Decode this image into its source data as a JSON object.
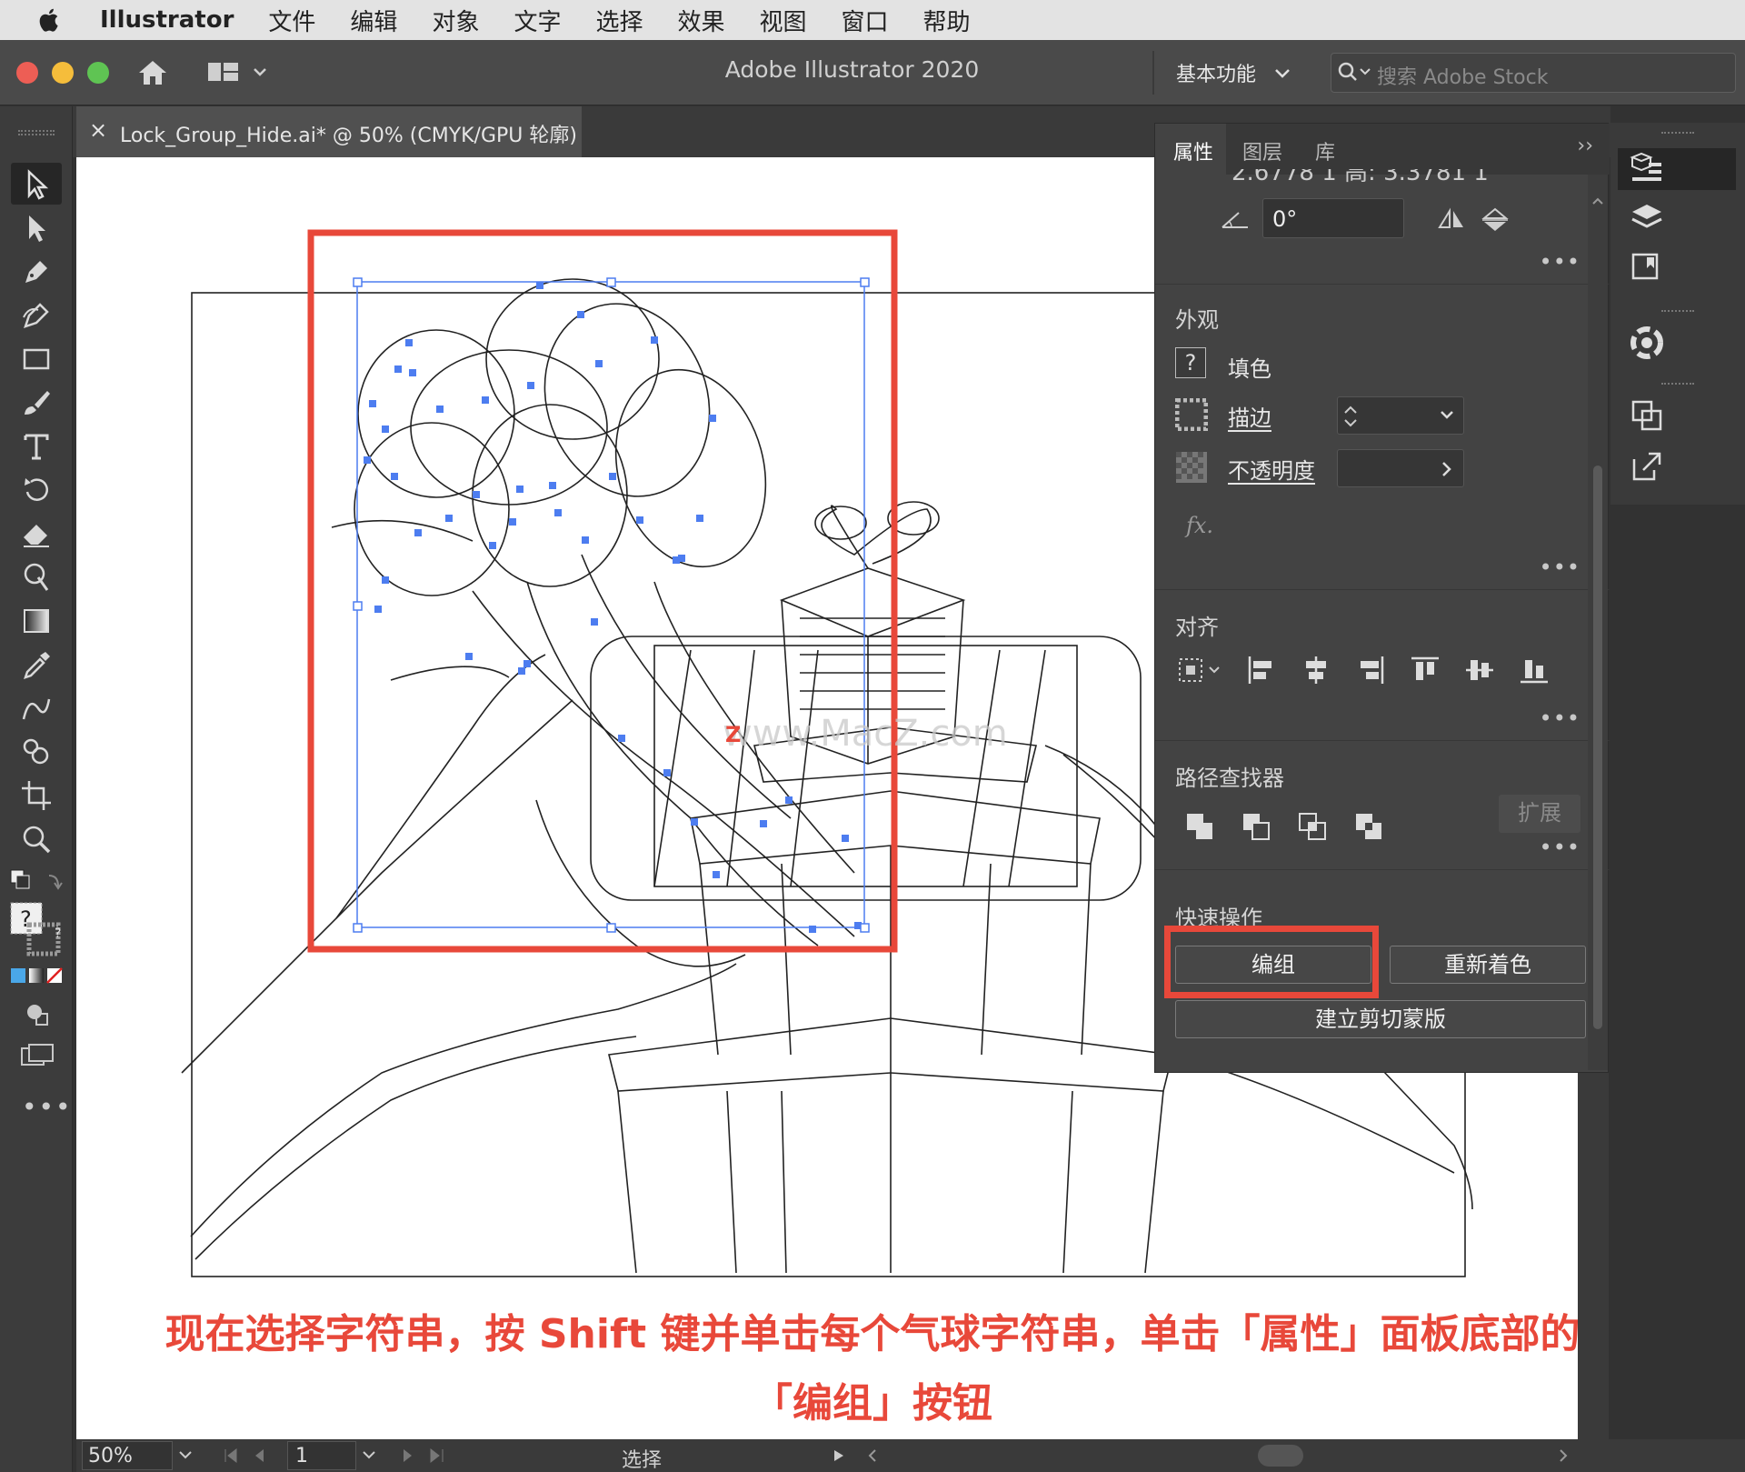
{
  "menubar": {
    "app_name": "Illustrator",
    "items": [
      "文件",
      "编辑",
      "对象",
      "文字",
      "选择",
      "效果",
      "视图",
      "窗口",
      "帮助"
    ]
  },
  "appbar": {
    "title": "Adobe Illustrator 2020",
    "workspace": "基本功能",
    "search_placeholder": "搜索 Adobe Stock"
  },
  "document_tab": {
    "close": "×",
    "title": "Lock_Group_Hide.ai* @ 50% (CMYK/GPU 轮廓)"
  },
  "panel": {
    "tabs": [
      "属性",
      "图层",
      "库"
    ],
    "transform": {
      "partial_values": "2.6778 1   高: 3.3781 1",
      "angle": "0°"
    },
    "appearance": {
      "title": "外观",
      "fill_label": "填色",
      "stroke_label": "描边",
      "opacity_label": "不透明度",
      "fx": "fx."
    },
    "align": {
      "title": "对齐"
    },
    "pathfinder": {
      "title": "路径查找器",
      "expand": "扩展"
    },
    "quick_actions": {
      "title": "快速操作",
      "group": "编组",
      "recolor": "重新着色",
      "clip_mask": "建立剪切蒙版"
    }
  },
  "statusbar": {
    "zoom": "50%",
    "artboard": "1",
    "tool": "选择"
  },
  "watermark": "www.MacZ.com",
  "caption": {
    "line1": "现在选择字符串，按 Shift 键并单击每个气球字符串，单击「属性」面板底部的",
    "line2": "「编组」按钮"
  },
  "colors": {
    "selection": "#4d7df0",
    "highlight": "#e8483a"
  }
}
